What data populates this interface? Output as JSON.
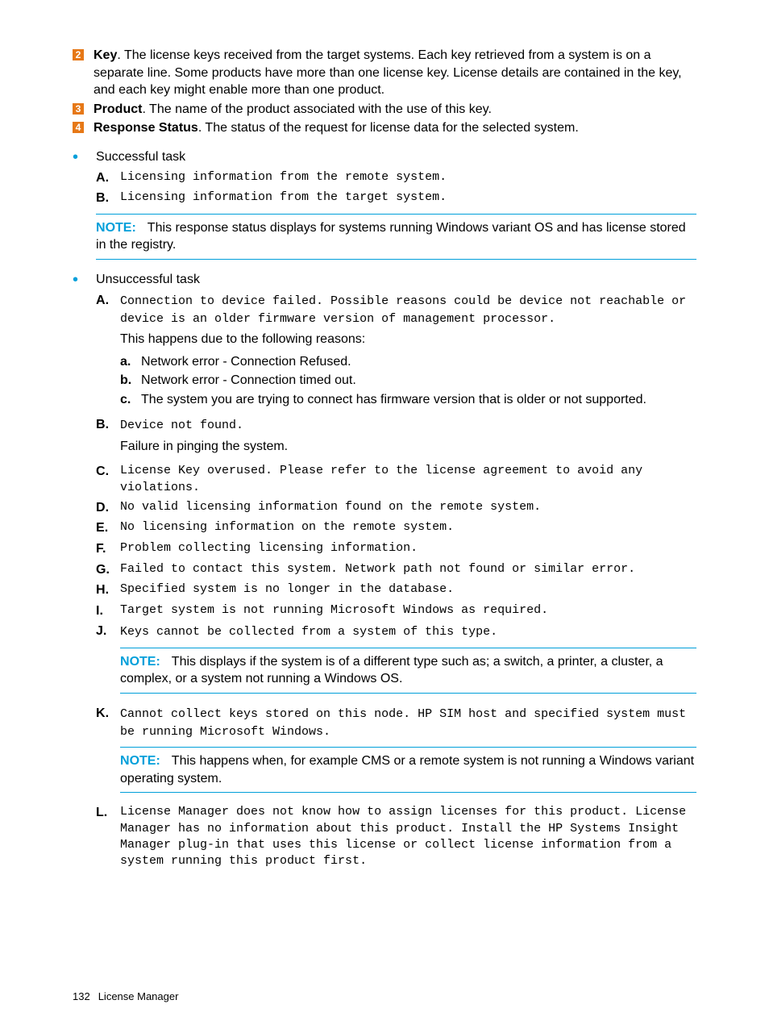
{
  "numbered": [
    {
      "n": "2",
      "term": "Key",
      "text": ". The license keys received from the target systems. Each key retrieved from a system is on a separate line. Some products have more than one license key. License details are contained in the key, and each key might enable more than one product."
    },
    {
      "n": "3",
      "term": "Product",
      "text": ". The name of the product associated with the use of this key."
    },
    {
      "n": "4",
      "term": "Response Status",
      "text": ". The status of the request for license data for the selected system."
    }
  ],
  "success": {
    "title": "Successful task",
    "items": [
      {
        "m": "A.",
        "mono": "Licensing information from the remote system."
      },
      {
        "m": "B.",
        "mono": "Licensing information from the target system."
      }
    ],
    "note": "This response status displays for systems running Windows variant OS and has license stored in the registry."
  },
  "fail": {
    "title": "Unsuccessful task",
    "A": {
      "m": "A.",
      "mono": "Connection to device failed. Possible reasons could be device not reachable or device is an older firmware version of management processor.",
      "intro": "This happens due to the following reasons:",
      "subs": [
        {
          "m": "a.",
          "t": "Network error - Connection Refused."
        },
        {
          "m": "b.",
          "t": "Network error - Connection timed out."
        },
        {
          "m": "c.",
          "t": "The system you are trying to connect has firmware version that is older or not supported."
        }
      ]
    },
    "B": {
      "m": "B.",
      "mono": "Device not found.",
      "after": "Failure in pinging the system."
    },
    "C": {
      "m": "C.",
      "mono": "License Key overused. Please refer to the license agreement to avoid any violations."
    },
    "D": {
      "m": "D.",
      "mono": "No valid licensing information found on the remote system."
    },
    "E": {
      "m": "E.",
      "mono": "No licensing information on the remote system."
    },
    "F": {
      "m": "F.",
      "mono": "Problem collecting licensing information."
    },
    "G": {
      "m": "G.",
      "mono": "Failed to contact this system. Network path not found or similar error."
    },
    "H": {
      "m": "H.",
      "mono": "Specified system is no longer in the database."
    },
    "I": {
      "m": "I.",
      "mono": "Target system is not running Microsoft Windows as required."
    },
    "J": {
      "m": "J.",
      "mono": "Keys cannot be collected from a system of this type.",
      "note": "This displays if the system is of a different type such as; a switch, a printer, a cluster, a complex, or a system not running a Windows OS."
    },
    "K": {
      "m": "K.",
      "mono": "Cannot collect keys stored on this node. HP SIM host and specified system must be running Microsoft Windows.",
      "note": "This happens when, for example CMS or a remote system is not running a Windows variant operating system."
    },
    "L": {
      "m": "L.",
      "mono": "License Manager does not know how to assign licenses for this product. License Manager has no information about this product. Install the HP Systems Insight Manager plug-in that uses this license or collect license information from a system running this product first."
    }
  },
  "noteLabel": "NOTE:",
  "footer": {
    "page": "132",
    "section": "License Manager"
  }
}
